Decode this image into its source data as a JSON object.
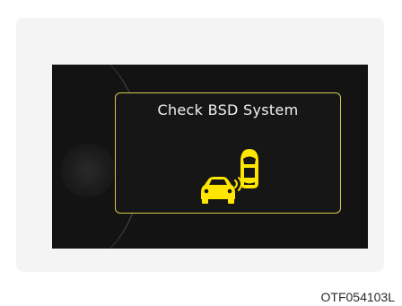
{
  "screen": {
    "message": "Check BSD System",
    "icon": "blind-spot-detection-icon",
    "colors": {
      "border": "#d4c84a",
      "icon": "#ffe600",
      "background": "#131313"
    }
  },
  "caption": "OTF054103L"
}
